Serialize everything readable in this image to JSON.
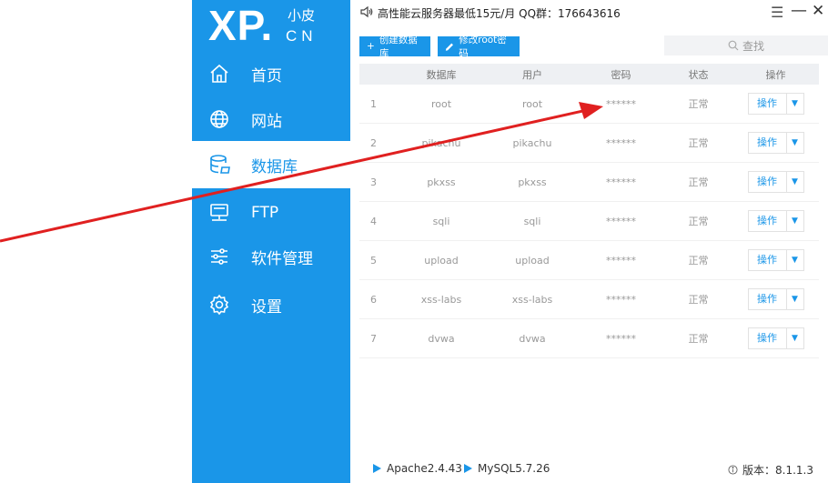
{
  "logo": {
    "main": "XP",
    "dot": ".",
    "small": "小皮",
    "cn": "CN"
  },
  "nav": [
    {
      "label": "首页",
      "icon": "home-icon"
    },
    {
      "label": "网站",
      "icon": "globe-icon"
    },
    {
      "label": "数据库",
      "icon": "database-icon",
      "active": true
    },
    {
      "label": "FTP",
      "icon": "ftp-icon"
    },
    {
      "label": "软件管理",
      "icon": "sliders-icon"
    },
    {
      "label": "设置",
      "icon": "gear-icon"
    }
  ],
  "topbar": {
    "announcement": "高性能云服务器最低15元/月 QQ群：176643616"
  },
  "toolbar": {
    "create_label": "创建数据库",
    "create_icon": "+",
    "pwd_label": "修改root密码"
  },
  "search": {
    "placeholder": "查找"
  },
  "table": {
    "headers": [
      "",
      "数据库",
      "用户",
      "密码",
      "状态",
      "操作"
    ],
    "rows": [
      {
        "idx": "1",
        "db": "root",
        "user": "root",
        "pwd": "******",
        "status": "正常",
        "op": "操作"
      },
      {
        "idx": "2",
        "db": "pikachu",
        "user": "pikachu",
        "pwd": "******",
        "status": "正常",
        "op": "操作"
      },
      {
        "idx": "3",
        "db": "pkxss",
        "user": "pkxss",
        "pwd": "******",
        "status": "正常",
        "op": "操作"
      },
      {
        "idx": "4",
        "db": "sqli",
        "user": "sqli",
        "pwd": "******",
        "status": "正常",
        "op": "操作"
      },
      {
        "idx": "5",
        "db": "upload",
        "user": "upload",
        "pwd": "******",
        "status": "正常",
        "op": "操作"
      },
      {
        "idx": "6",
        "db": "xss-labs",
        "user": "xss-labs",
        "pwd": "******",
        "status": "正常",
        "op": "操作"
      },
      {
        "idx": "7",
        "db": "dvwa",
        "user": "dvwa",
        "pwd": "******",
        "status": "正常",
        "op": "操作"
      }
    ]
  },
  "footer": {
    "apache": "Apache2.4.43",
    "mysql": "MySQL5.7.26",
    "version": "版本：8.1.1.3"
  },
  "colors": {
    "accent": "#1a96e8",
    "annotation": "#e02020"
  }
}
